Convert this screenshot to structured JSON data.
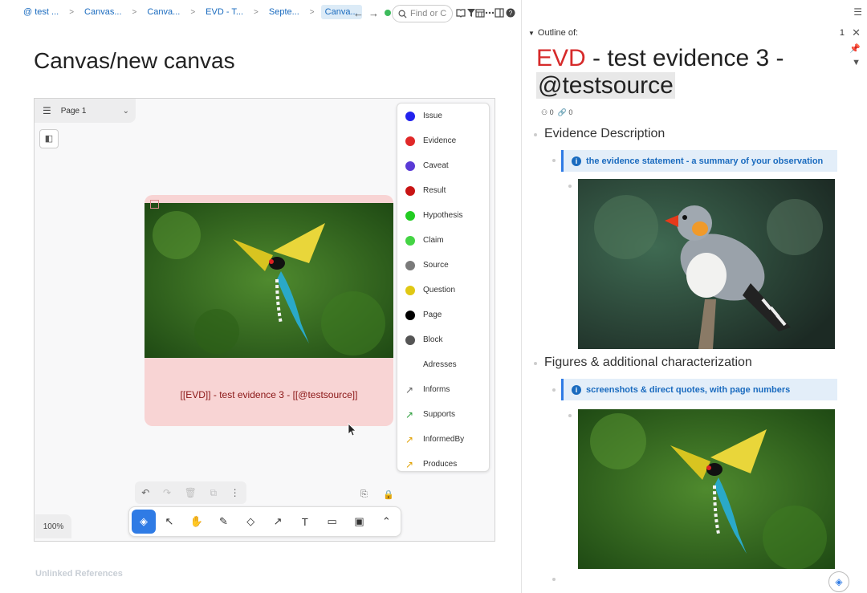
{
  "breadcrumbs": [
    "@ test ...",
    "Canvas...",
    "Canva...",
    "EVD - T...",
    "Septe...",
    "Canva..."
  ],
  "search": {
    "placeholder": "Find or C"
  },
  "page": {
    "title": "Canvas/new canvas"
  },
  "canvas": {
    "page_selector": "Page 1",
    "zoom": "100%",
    "node": {
      "text": "[[EVD]] - test evidence 3 - [[@testsource]]"
    },
    "types": [
      {
        "label": "Issue",
        "color": "#2222ee",
        "kind": "node"
      },
      {
        "label": "Evidence",
        "color": "#e02828",
        "kind": "node"
      },
      {
        "label": "Caveat",
        "color": "#5a3ad6",
        "kind": "node"
      },
      {
        "label": "Result",
        "color": "#c81414",
        "kind": "node"
      },
      {
        "label": "Hypothesis",
        "color": "#22cc22",
        "kind": "node"
      },
      {
        "label": "Claim",
        "color": "#44d444",
        "kind": "node"
      },
      {
        "label": "Source",
        "color": "#7a7a7a",
        "kind": "node"
      },
      {
        "label": "Question",
        "color": "#e0c814",
        "kind": "node"
      },
      {
        "label": "Page",
        "color": "#000000",
        "kind": "node"
      },
      {
        "label": "Block",
        "color": "#555555",
        "kind": "node"
      },
      {
        "label": "Adresses",
        "color": "",
        "kind": "blank"
      },
      {
        "label": "Informs",
        "color": "#666666",
        "kind": "relation"
      },
      {
        "label": "Supports",
        "color": "#2a9d3a",
        "kind": "relation"
      },
      {
        "label": "InformedBy",
        "color": "#e0a000",
        "kind": "relation"
      },
      {
        "label": "Produces",
        "color": "#e0a000",
        "kind": "relation"
      }
    ]
  },
  "unlinked_refs": "Unlinked References",
  "outline": {
    "label": "Outline of:",
    "count": "1",
    "title_evd": "EVD",
    "title_rest": " - test evidence 3 - ",
    "title_source": "@testsource",
    "meta_hierarchy": "0",
    "meta_links": "0",
    "sections": [
      {
        "heading": "Evidence Description",
        "callout": "the evidence statement - a summary of your observation"
      },
      {
        "heading": "Figures & additional characterization",
        "callout": "screenshots & direct quotes, with page numbers"
      }
    ]
  }
}
